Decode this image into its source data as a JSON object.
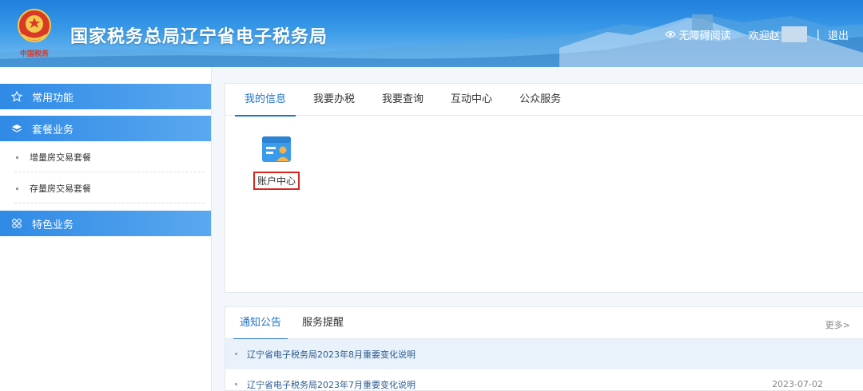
{
  "header": {
    "title": "国家税务总局辽宁省电子税务局",
    "accessibility_label": "无障碍阅读",
    "welcome_label": "欢迎赵",
    "separator": "|",
    "logout_label": "退出",
    "emblem_text": "中国税务"
  },
  "sidebar": {
    "groups": [
      {
        "label": "常用功能",
        "icon": "star-icon"
      },
      {
        "label": "套餐业务",
        "icon": "layers-icon"
      },
      {
        "label": "特色业务",
        "icon": "grid-icon"
      }
    ],
    "package_items": [
      {
        "label": "增量房交易套餐"
      },
      {
        "label": "存量房交易套餐"
      }
    ]
  },
  "main": {
    "tabs": [
      {
        "label": "我的信息",
        "active": true
      },
      {
        "label": "我要办税",
        "active": false
      },
      {
        "label": "我要查询",
        "active": false
      },
      {
        "label": "互动中心",
        "active": false
      },
      {
        "label": "公众服务",
        "active": false
      }
    ],
    "apps": [
      {
        "label": "账户中心",
        "icon": "account-card-icon"
      }
    ]
  },
  "notice": {
    "tabs": [
      {
        "label": "通知公告",
        "active": true
      },
      {
        "label": "服务提醒",
        "active": false
      }
    ],
    "more_label": "更多>",
    "items": [
      {
        "title": "辽宁省电子税务局2023年8月重要变化说明",
        "date": ""
      },
      {
        "title": "辽宁省电子税务局2023年7月重要变化说明",
        "date": "2023-07-02"
      }
    ]
  },
  "colors": {
    "accent": "#1f73c9",
    "sidebar_group": "#2f8ae6",
    "highlight_border": "#d9261c"
  }
}
